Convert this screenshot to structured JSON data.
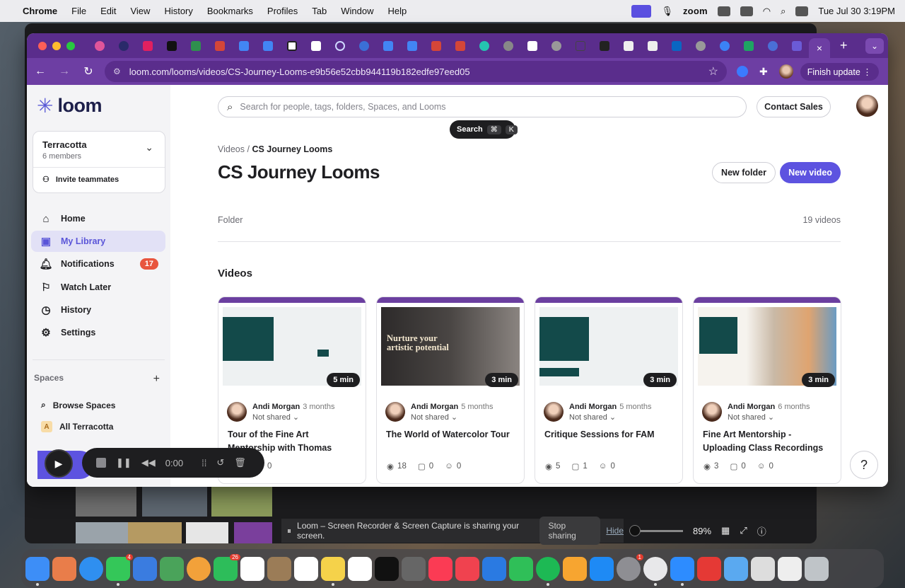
{
  "menubar": {
    "apple": "",
    "app": "Chrome",
    "items": [
      "File",
      "Edit",
      "View",
      "History",
      "Bookmarks",
      "Profiles",
      "Tab",
      "Window",
      "Help"
    ],
    "zoom_label": "zoom",
    "datetime": "Tue Jul 30  3:19PM"
  },
  "browser": {
    "url": "loom.com/looms/videos/CS-Journey-Looms-e9b56e52cbb944119b182edfe97eed05",
    "finish_update": "Finish update",
    "new_tab": "+",
    "close_tab": "×"
  },
  "sidebar": {
    "logo": "loom",
    "workspace": {
      "name": "Terracotta",
      "members": "6 members",
      "invite": "Invite teammates"
    },
    "nav": [
      {
        "label": "Home",
        "icon": "home-icon"
      },
      {
        "label": "My Library",
        "icon": "library-icon",
        "active": true
      },
      {
        "label": "Notifications",
        "icon": "bell-icon",
        "badge": "17"
      },
      {
        "label": "Watch Later",
        "icon": "bookmark-icon"
      },
      {
        "label": "History",
        "icon": "clock-icon"
      },
      {
        "label": "Settings",
        "icon": "gear-icon"
      }
    ],
    "spaces_label": "Spaces",
    "spaces_add": "+",
    "browse_spaces": "Browse Spaces",
    "all_space": {
      "letter": "A",
      "label": "All Terracotta"
    }
  },
  "recorder": {
    "time": "0:00"
  },
  "main": {
    "search_placeholder": "Search for people, tags, folders, Spaces, and Looms",
    "contact_sales": "Contact Sales",
    "search_tip": {
      "label": "Search",
      "key1": "⌘",
      "key2": "K"
    },
    "breadcrumb_parent": "Videos",
    "breadcrumb_sep": "/",
    "breadcrumb_current": "CS Journey Looms",
    "title": "CS Journey Looms",
    "new_folder": "New folder",
    "new_video": "New video",
    "folder_label": "Folder",
    "video_count": "19 videos",
    "videos_heading": "Videos",
    "help": "?"
  },
  "videos": [
    {
      "duration": "5 min",
      "author": "Andi Morgan",
      "ago": "3 months",
      "sharing": "Not shared",
      "title": "Tour of the Fine Art Mentorship with Thomas Schaller",
      "views": "",
      "comments": "0",
      "reactions": "0",
      "thumb_text": ""
    },
    {
      "duration": "3 min",
      "author": "Andi Morgan",
      "ago": "5 months",
      "sharing": "Not shared",
      "title": "The World of Watercolor Tour",
      "views": "18",
      "comments": "0",
      "reactions": "0",
      "thumb_text": "Nurture your artistic potential"
    },
    {
      "duration": "3 min",
      "author": "Andi Morgan",
      "ago": "5 months",
      "sharing": "Not shared",
      "title": "Critique Sessions for FAM",
      "views": "5",
      "comments": "1",
      "reactions": "0",
      "thumb_text": ""
    },
    {
      "duration": "3 min",
      "author": "Andi Morgan",
      "ago": "6 months",
      "sharing": "Not shared",
      "title": "Fine Art Mentorship - Uploading Class Recordings",
      "views": "3",
      "comments": "0",
      "reactions": "0",
      "thumb_text": ""
    }
  ],
  "screenshare": {
    "message": "Loom – Screen Recorder & Screen Capture is sharing your screen.",
    "stop": "Stop sharing",
    "hide": "Hide",
    "zoom_pct": "89%"
  },
  "colors": {
    "accent": "#5d53e0",
    "tabstrip": "#5a2d8c",
    "toolbar": "#6d3ea3",
    "badge": "#e8553e"
  }
}
